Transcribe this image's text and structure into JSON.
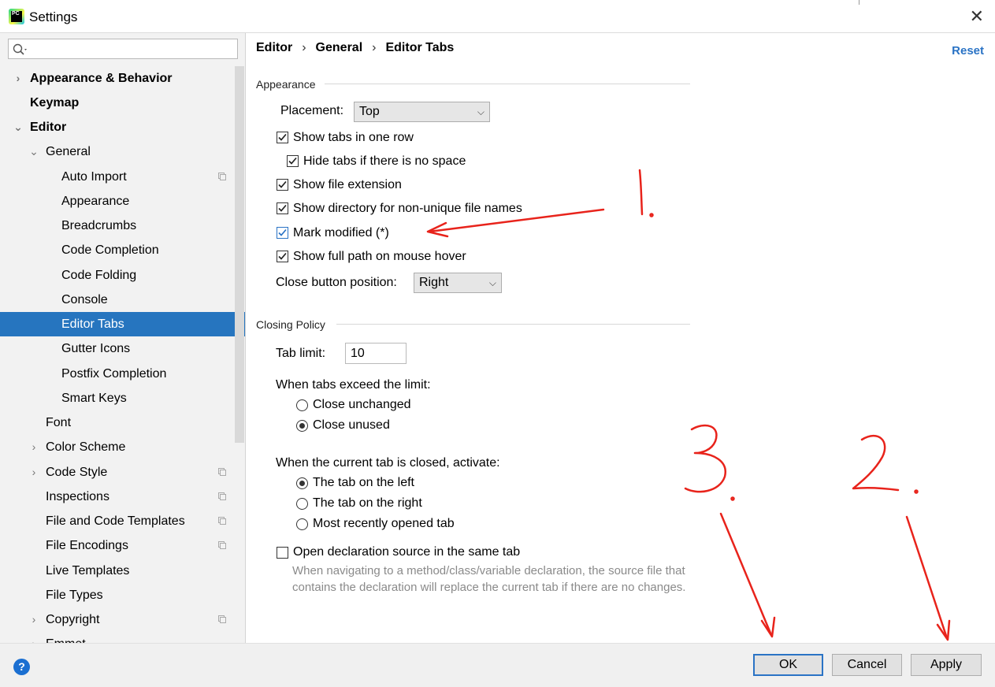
{
  "window": {
    "title": "Settings",
    "app_icon": "pycharm-icon",
    "close_icon": "close-icon"
  },
  "sidebar": {
    "search_placeholder": "",
    "items": [
      {
        "label": "Appearance & Behavior",
        "arrow": "›"
      },
      {
        "label": "Keymap",
        "arrow": ""
      },
      {
        "label": "Editor",
        "arrow": "⌄"
      },
      {
        "label": "General",
        "arrow": "⌄"
      },
      {
        "label": "Auto Import",
        "arrow": ""
      },
      {
        "label": "Appearance",
        "arrow": ""
      },
      {
        "label": "Breadcrumbs",
        "arrow": ""
      },
      {
        "label": "Code Completion",
        "arrow": ""
      },
      {
        "label": "Code Folding",
        "arrow": ""
      },
      {
        "label": "Console",
        "arrow": ""
      },
      {
        "label": "Editor Tabs",
        "arrow": ""
      },
      {
        "label": "Gutter Icons",
        "arrow": ""
      },
      {
        "label": "Postfix Completion",
        "arrow": ""
      },
      {
        "label": "Smart Keys",
        "arrow": ""
      },
      {
        "label": "Font",
        "arrow": ""
      },
      {
        "label": "Color Scheme",
        "arrow": "›"
      },
      {
        "label": "Code Style",
        "arrow": "›"
      },
      {
        "label": "Inspections",
        "arrow": ""
      },
      {
        "label": "File and Code Templates",
        "arrow": ""
      },
      {
        "label": "File Encodings",
        "arrow": ""
      },
      {
        "label": "Live Templates",
        "arrow": ""
      },
      {
        "label": "File Types",
        "arrow": ""
      },
      {
        "label": "Copyright",
        "arrow": "›"
      },
      {
        "label": "Emmet",
        "arrow": "›"
      }
    ]
  },
  "breadcrumb": {
    "part1": "Editor",
    "part2": "General",
    "part3": "Editor Tabs",
    "sep": "›"
  },
  "reset_label": "Reset",
  "appearance": {
    "section_title": "Appearance",
    "placement_label": "Placement:",
    "placement_value": "Top",
    "show_tabs_one_row": "Show tabs in one row",
    "hide_tabs": "Hide tabs if there is no space",
    "show_file_ext": "Show file extension",
    "show_directory": "Show directory for non-unique file names",
    "mark_modified": "Mark modified (*)",
    "show_full_path": "Show full path on mouse hover",
    "close_button_label": "Close button position:",
    "close_button_value": "Right"
  },
  "closing": {
    "section_title": "Closing Policy",
    "tab_limit_label": "Tab limit:",
    "tab_limit_value": "10",
    "exceed_label": "When tabs exceed the limit:",
    "close_unchanged": "Close unchanged",
    "close_unused": "Close unused",
    "activate_label": "When the current tab is closed, activate:",
    "tab_left": "The tab on the left",
    "tab_right": "The tab on the right",
    "most_recent": "Most recently opened tab",
    "open_declaration": "Open declaration source in the same tab",
    "description": "When navigating to a method/class/variable declaration, the source file that contains the declaration will replace the current tab if there are no changes."
  },
  "buttons": {
    "help": "?",
    "ok": "OK",
    "cancel": "Cancel",
    "apply": "Apply"
  },
  "annotations": {
    "one": "1.",
    "two": "2.",
    "three": "3.",
    "color": "#e8231b"
  }
}
